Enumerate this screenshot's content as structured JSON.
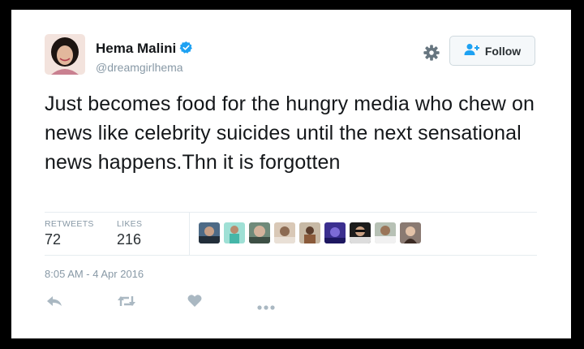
{
  "author": {
    "name": "Hema Malini",
    "handle": "@dreamgirlhema"
  },
  "follow_label": "Follow",
  "tweet_text": "Just becomes food for the hungry media who chew on news like celebrity suicides until the next sensational news happens.Thn it is forgotten",
  "stats": {
    "retweets_label": "RETWEETS",
    "retweets_value": "72",
    "likes_label": "LIKES",
    "likes_value": "216"
  },
  "timestamp": "8:05 AM - 4 Apr 2016",
  "colors": {
    "verified": "#1da1f2",
    "follow_icon": "#1da1f2",
    "action_icons": "#aab8c2",
    "gear": "#66757f"
  },
  "likers_count": 9
}
